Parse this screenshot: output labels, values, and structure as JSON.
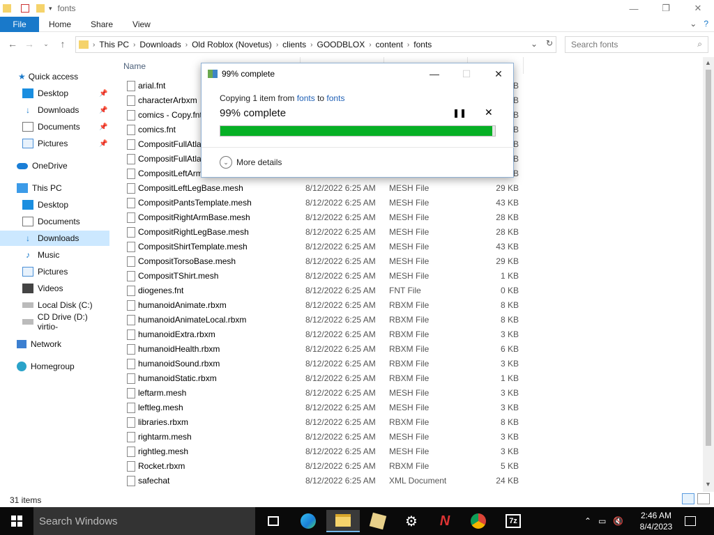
{
  "window": {
    "title": "fonts",
    "minimize": "—",
    "maximize": "❐",
    "close": "✕"
  },
  "ribbon": {
    "tabs": [
      "File",
      "Home",
      "Share",
      "View"
    ]
  },
  "address": {
    "crumbs": [
      "This PC",
      "Downloads",
      "Old Roblox (Novetus)",
      "clients",
      "GOODBLOX",
      "content",
      "fonts"
    ],
    "search_placeholder": "Search fonts"
  },
  "sidebar": {
    "items": [
      {
        "label": "Quick access",
        "icon": "star-icon",
        "pinned": false
      },
      {
        "label": "Desktop",
        "icon": "desktop-icon",
        "pinned": true
      },
      {
        "label": "Downloads",
        "icon": "download-icon",
        "pinned": true
      },
      {
        "label": "Documents",
        "icon": "documents-icon",
        "pinned": true
      },
      {
        "label": "Pictures",
        "icon": "pictures-icon",
        "pinned": true
      },
      {
        "label": "OneDrive",
        "icon": "cloud-icon",
        "pinned": false
      },
      {
        "label": "This PC",
        "icon": "computer-icon",
        "pinned": false
      },
      {
        "label": "Desktop",
        "icon": "desktop-icon",
        "pinned": false
      },
      {
        "label": "Documents",
        "icon": "documents-icon",
        "pinned": false
      },
      {
        "label": "Downloads",
        "icon": "download-icon",
        "pinned": false
      },
      {
        "label": "Music",
        "icon": "music-icon",
        "pinned": false
      },
      {
        "label": "Pictures",
        "icon": "pictures-icon",
        "pinned": false
      },
      {
        "label": "Videos",
        "icon": "videos-icon",
        "pinned": false
      },
      {
        "label": "Local Disk (C:)",
        "icon": "disk-icon",
        "pinned": false
      },
      {
        "label": "CD Drive (D:) virtio-",
        "icon": "cd-icon",
        "pinned": false
      },
      {
        "label": "Network",
        "icon": "network-icon",
        "pinned": false
      },
      {
        "label": "Homegroup",
        "icon": "homegroup-icon",
        "pinned": false
      }
    ]
  },
  "filelist": {
    "header_name": "Name",
    "rows": [
      {
        "name": "arial.fnt",
        "date": "",
        "type": "",
        "size": "KB"
      },
      {
        "name": "characterArbxm",
        "date": "",
        "type": "",
        "size": "KB"
      },
      {
        "name": "comics - Copy.fnt",
        "date": "",
        "type": "",
        "size": "KB"
      },
      {
        "name": "comics.fnt",
        "date": "",
        "type": "",
        "size": "KB"
      },
      {
        "name": "CompositFullAtla",
        "date": "",
        "type": "",
        "size": "KB"
      },
      {
        "name": "CompositFullAtla",
        "date": "",
        "type": "",
        "size": "KB"
      },
      {
        "name": "CompositLeftArm",
        "date": "",
        "type": "",
        "size": "KB"
      },
      {
        "name": "CompositLeftLegBase.mesh",
        "date": "8/12/2022 6:25 AM",
        "type": "MESH File",
        "size": "29 KB"
      },
      {
        "name": "CompositPantsTemplate.mesh",
        "date": "8/12/2022 6:25 AM",
        "type": "MESH File",
        "size": "43 KB"
      },
      {
        "name": "CompositRightArmBase.mesh",
        "date": "8/12/2022 6:25 AM",
        "type": "MESH File",
        "size": "28 KB"
      },
      {
        "name": "CompositRightLegBase.mesh",
        "date": "8/12/2022 6:25 AM",
        "type": "MESH File",
        "size": "28 KB"
      },
      {
        "name": "CompositShirtTemplate.mesh",
        "date": "8/12/2022 6:25 AM",
        "type": "MESH File",
        "size": "43 KB"
      },
      {
        "name": "CompositTorsoBase.mesh",
        "date": "8/12/2022 6:25 AM",
        "type": "MESH File",
        "size": "29 KB"
      },
      {
        "name": "CompositTShirt.mesh",
        "date": "8/12/2022 6:25 AM",
        "type": "MESH File",
        "size": "1 KB"
      },
      {
        "name": "diogenes.fnt",
        "date": "8/12/2022 6:25 AM",
        "type": "FNT File",
        "size": "0 KB"
      },
      {
        "name": "humanoidAnimate.rbxm",
        "date": "8/12/2022 6:25 AM",
        "type": "RBXM File",
        "size": "8 KB"
      },
      {
        "name": "humanoidAnimateLocal.rbxm",
        "date": "8/12/2022 6:25 AM",
        "type": "RBXM File",
        "size": "8 KB"
      },
      {
        "name": "humanoidExtra.rbxm",
        "date": "8/12/2022 6:25 AM",
        "type": "RBXM File",
        "size": "3 KB"
      },
      {
        "name": "humanoidHealth.rbxm",
        "date": "8/12/2022 6:25 AM",
        "type": "RBXM File",
        "size": "6 KB"
      },
      {
        "name": "humanoidSound.rbxm",
        "date": "8/12/2022 6:25 AM",
        "type": "RBXM File",
        "size": "3 KB"
      },
      {
        "name": "humanoidStatic.rbxm",
        "date": "8/12/2022 6:25 AM",
        "type": "RBXM File",
        "size": "1 KB"
      },
      {
        "name": "leftarm.mesh",
        "date": "8/12/2022 6:25 AM",
        "type": "MESH File",
        "size": "3 KB"
      },
      {
        "name": "leftleg.mesh",
        "date": "8/12/2022 6:25 AM",
        "type": "MESH File",
        "size": "3 KB"
      },
      {
        "name": "libraries.rbxm",
        "date": "8/12/2022 6:25 AM",
        "type": "RBXM File",
        "size": "8 KB"
      },
      {
        "name": "rightarm.mesh",
        "date": "8/12/2022 6:25 AM",
        "type": "MESH File",
        "size": "3 KB"
      },
      {
        "name": "rightleg.mesh",
        "date": "8/12/2022 6:25 AM",
        "type": "MESH File",
        "size": "3 KB"
      },
      {
        "name": "Rocket.rbxm",
        "date": "8/12/2022 6:25 AM",
        "type": "RBXM File",
        "size": "5 KB"
      },
      {
        "name": "safechat",
        "date": "8/12/2022 6:25 AM",
        "type": "XML Document",
        "size": "24 KB"
      }
    ]
  },
  "status": {
    "count": "31 items"
  },
  "dialog": {
    "title": "99% complete",
    "copy_prefix": "Copying 1 item from ",
    "from": "fonts",
    "to_word": " to ",
    "to": "fonts",
    "big": "99% complete",
    "progress": 0.99,
    "more": "More details"
  },
  "taskbar": {
    "search": "Search Windows",
    "time": "2:46 AM",
    "date": "8/4/2023",
    "apps": [
      "task-view-icon",
      "edge-icon",
      "file-explorer-icon",
      "roblox-icon",
      "settings-icon",
      "novetus-icon",
      "chrome-icon",
      "7zip-icon"
    ]
  },
  "colors": {
    "accent": "#1979ca",
    "progress": "#06b025",
    "selected": "#cce8ff"
  }
}
